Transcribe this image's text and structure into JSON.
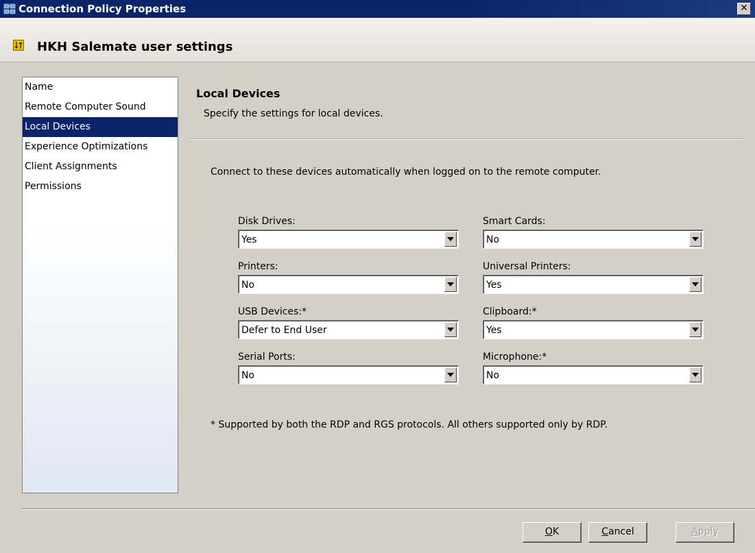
{
  "window": {
    "title": "Connection Policy Properties",
    "close_label": "✕"
  },
  "header": {
    "policy_name": "HKH Salemate user settings"
  },
  "nav": {
    "items": [
      {
        "label": "Name"
      },
      {
        "label": "Remote Computer Sound"
      },
      {
        "label": "Local Devices",
        "selected": true
      },
      {
        "label": "Experience Optimizations"
      },
      {
        "label": "Client Assignments"
      },
      {
        "label": "Permissions"
      }
    ]
  },
  "section": {
    "title": "Local Devices",
    "subtitle": "Specify the settings for local devices."
  },
  "intro": "Connect to these devices automatically when logged on to the remote computer.",
  "fields": {
    "disk_drives": {
      "label": "Disk Drives:",
      "value": "Yes"
    },
    "smart_cards": {
      "label": "Smart Cards:",
      "value": "No"
    },
    "printers": {
      "label": "Printers:",
      "value": "No"
    },
    "universal_printers": {
      "label": "Universal Printers:",
      "value": "Yes"
    },
    "usb_devices": {
      "label": "USB Devices:*",
      "value": "Defer to End User"
    },
    "clipboard": {
      "label": "Clipboard:*",
      "value": "Yes"
    },
    "serial_ports": {
      "label": "Serial Ports:",
      "value": "No"
    },
    "microphone": {
      "label": "Microphone:*",
      "value": "No"
    }
  },
  "note": "* Supported by both the RDP and RGS protocols.  All others supported only by RDP.",
  "buttons": {
    "ok": {
      "mnemonic": "O",
      "rest": "K"
    },
    "cancel": {
      "mnemonic": "C",
      "rest": "ancel"
    },
    "apply": {
      "mnemonic": "A",
      "rest": "pply"
    }
  }
}
